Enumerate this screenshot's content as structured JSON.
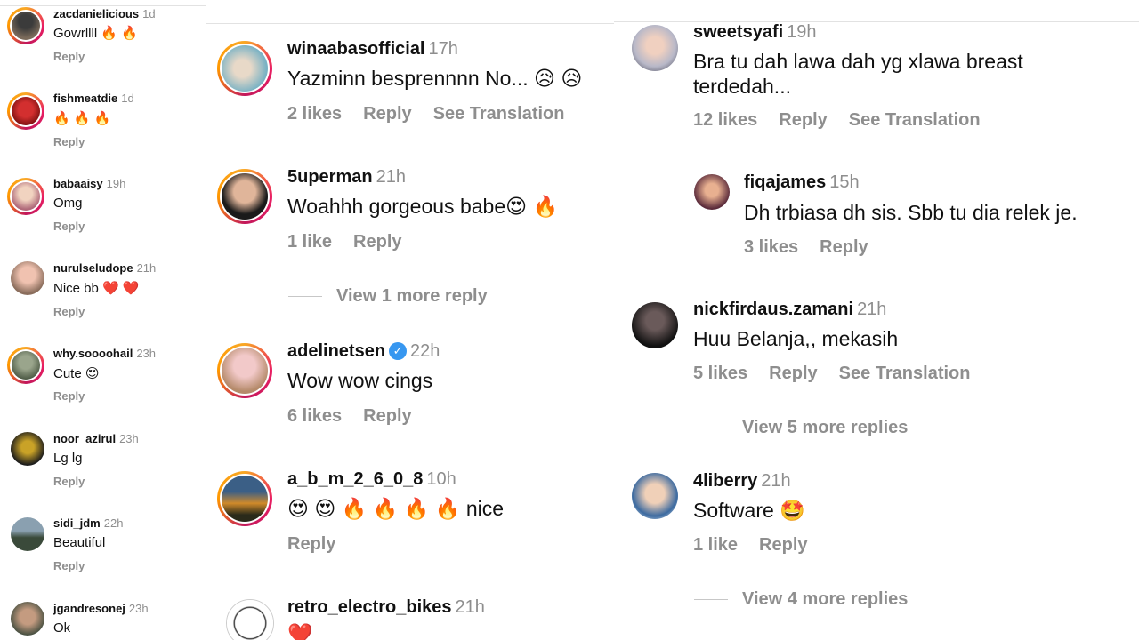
{
  "panel1": {
    "comments": [
      {
        "user": "zacdanielicious",
        "time": "1d",
        "text": "Gowrllll 🔥 🔥",
        "reply": "Reply"
      },
      {
        "user": "fishmeatdie",
        "time": "1d",
        "text": "🔥 🔥 🔥",
        "reply": "Reply"
      },
      {
        "user": "babaaisy",
        "time": "19h",
        "text": "Omg",
        "reply": "Reply"
      },
      {
        "user": "nurulseludope",
        "time": "21h",
        "text": "Nice bb ❤️ ❤️",
        "reply": "Reply"
      },
      {
        "user": "why.soooohail",
        "time": "23h",
        "text": "Cute 😍",
        "reply": "Reply"
      },
      {
        "user": "noor_azirul",
        "time": "23h",
        "text": "Lg lg",
        "reply": "Reply"
      },
      {
        "user": "sidi_jdm",
        "time": "22h",
        "text": "Beautiful",
        "reply": "Reply"
      },
      {
        "user": "jgandresonej",
        "time": "23h",
        "text": "Ok",
        "reply": ""
      }
    ]
  },
  "panel2": {
    "comments": [
      {
        "user": "winaabasofficial",
        "time": "17h",
        "text": "Yazminn besprennnn No... 😥 😥",
        "likes": "2 likes",
        "reply": "Reply",
        "translate": "See Translation"
      },
      {
        "user": "5uperman",
        "time": "21h",
        "text": "Woahhh gorgeous babe😍 🔥",
        "likes": "1 like",
        "reply": "Reply",
        "translate": ""
      },
      {
        "user": "adelinetsen",
        "time": "22h",
        "text": "Wow wow cings",
        "likes": "6 likes",
        "reply": "Reply",
        "translate": ""
      },
      {
        "user": "a_b_m_2_6_0_8",
        "time": "10h",
        "text": "😍 😍 🔥 🔥 🔥 🔥  nice",
        "likes": "",
        "reply": "Reply",
        "translate": ""
      },
      {
        "user": "retro_electro_bikes",
        "time": "21h",
        "text": "❤️",
        "likes": "",
        "reply": "",
        "translate": ""
      }
    ],
    "view_more": "View 1 more reply",
    "verified_mark": "✓"
  },
  "panel3": {
    "comments": [
      {
        "user": "sweetsyafi",
        "time": "19h",
        "text1": "Bra tu dah lawa dah yg xlawa breast",
        "text2": "terdedah...",
        "likes": "12 likes",
        "reply": "Reply",
        "translate": "See Translation"
      },
      {
        "user": "fiqajames",
        "time": "15h",
        "text1": "Dh trbiasa dh sis. Sbb tu dia relek je.",
        "likes": "3 likes",
        "reply": "Reply"
      },
      {
        "user": "nickfirdaus.zamani",
        "time": "21h",
        "text1": "Huu Belanja,, mekasih",
        "likes": "5 likes",
        "reply": "Reply",
        "translate": "See Translation"
      },
      {
        "user": "4liberry",
        "time": "21h",
        "text1": "Software 🤩",
        "likes": "1 like",
        "reply": "Reply"
      }
    ],
    "view_more_1": "View 5 more replies",
    "view_more_2": "View 4 more replies"
  },
  "colors": {
    "ring_accent": "#e91e63",
    "muted": "#8e8e8e",
    "verified": "#3797f0"
  }
}
